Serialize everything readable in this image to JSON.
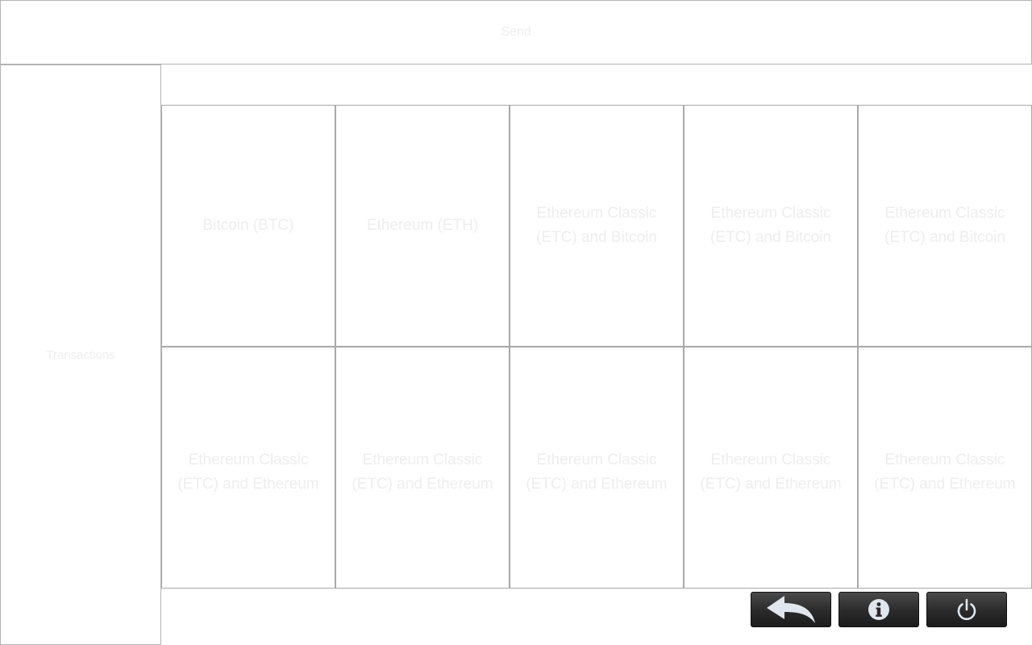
{
  "header": {
    "title": "Send"
  },
  "sidebar": {
    "label": "Transactions"
  },
  "grid": {
    "cells": [
      {
        "label": "Bitcoin (BTC)"
      },
      {
        "label": "Ethereum (ETH)"
      },
      {
        "label": "Ethereum Classic (ETC) and Bitcoin"
      },
      {
        "label": "Ethereum Classic (ETC) and Bitcoin"
      },
      {
        "label": "Ethereum Classic (ETC) and Bitcoin"
      },
      {
        "label": "Ethereum Classic (ETC) and Ethereum"
      },
      {
        "label": "Ethereum Classic (ETC) and Ethereum"
      },
      {
        "label": "Ethereum Classic (ETC) and Ethereum"
      },
      {
        "label": "Ethereum Classic (ETC) and Ethereum"
      },
      {
        "label": "Ethereum Classic (ETC) and Ethereum"
      }
    ]
  },
  "toolbar": {
    "buttons": [
      {
        "icon": "back-arrow-icon"
      },
      {
        "icon": "info-icon"
      },
      {
        "icon": "power-icon"
      }
    ]
  },
  "colors": {
    "border": "#b4b4b4",
    "button_dark": "#2a2a2a",
    "icon_light": "#dfe6ee",
    "faint_text": "#eeeeee"
  }
}
